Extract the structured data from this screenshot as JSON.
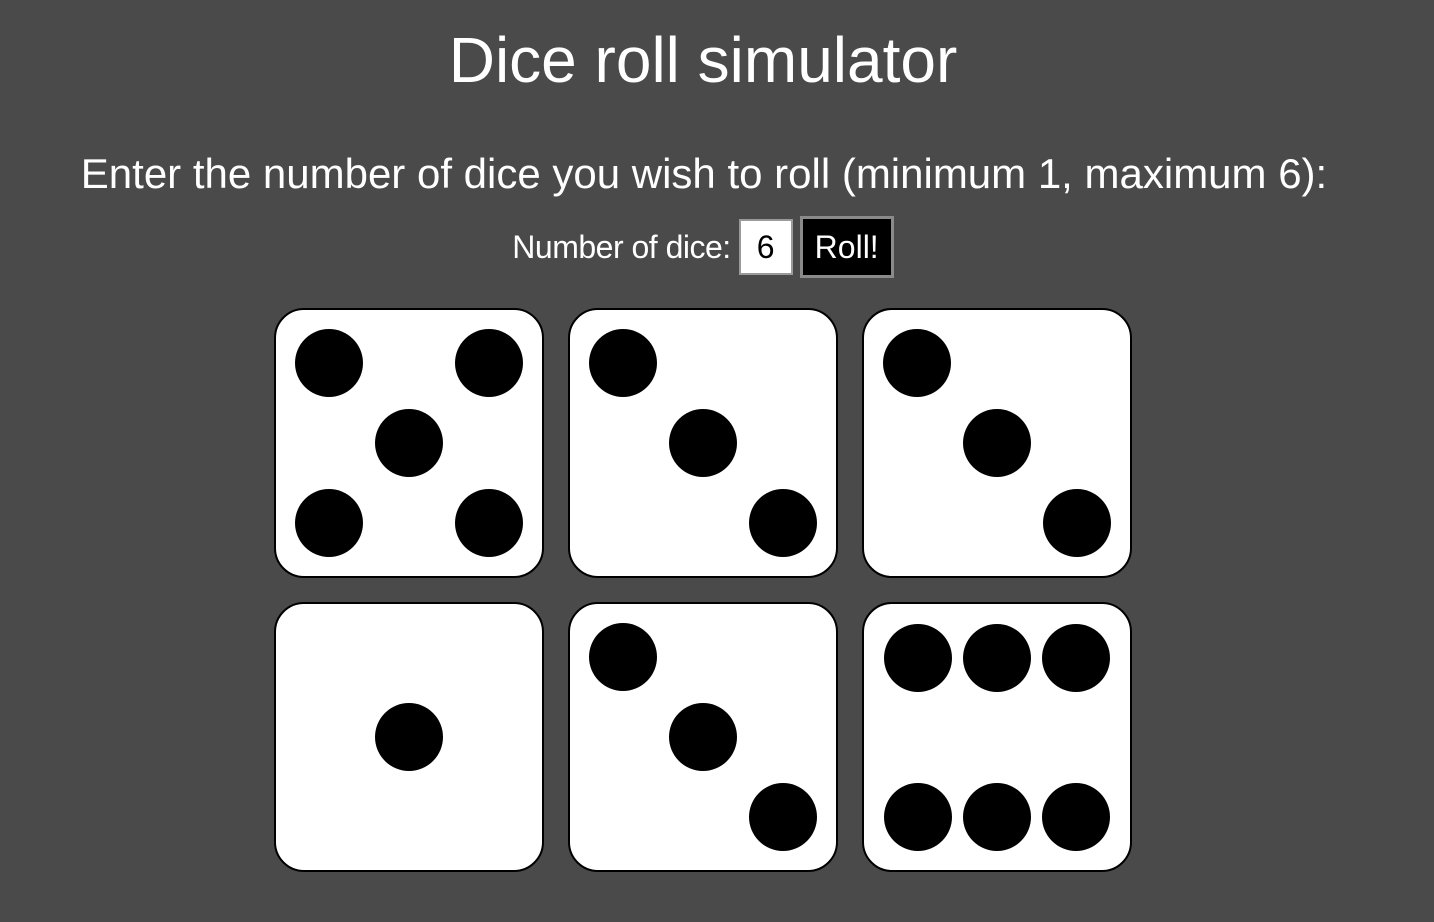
{
  "page": {
    "title": "Dice roll simulator",
    "instructions": "Enter the number of dice you wish to roll (minimum 1, maximum 6):"
  },
  "controls": {
    "label": "Number of dice:",
    "input_value": "6",
    "roll_label": "Roll!"
  },
  "dice": [
    {
      "value": 5
    },
    {
      "value": 3
    },
    {
      "value": 3
    },
    {
      "value": 1
    },
    {
      "value": 3
    },
    {
      "value": 6
    }
  ],
  "colors": {
    "background": "#4a4a4a",
    "die_face": "#ffffff",
    "pip": "#000000",
    "button": "#000000"
  }
}
